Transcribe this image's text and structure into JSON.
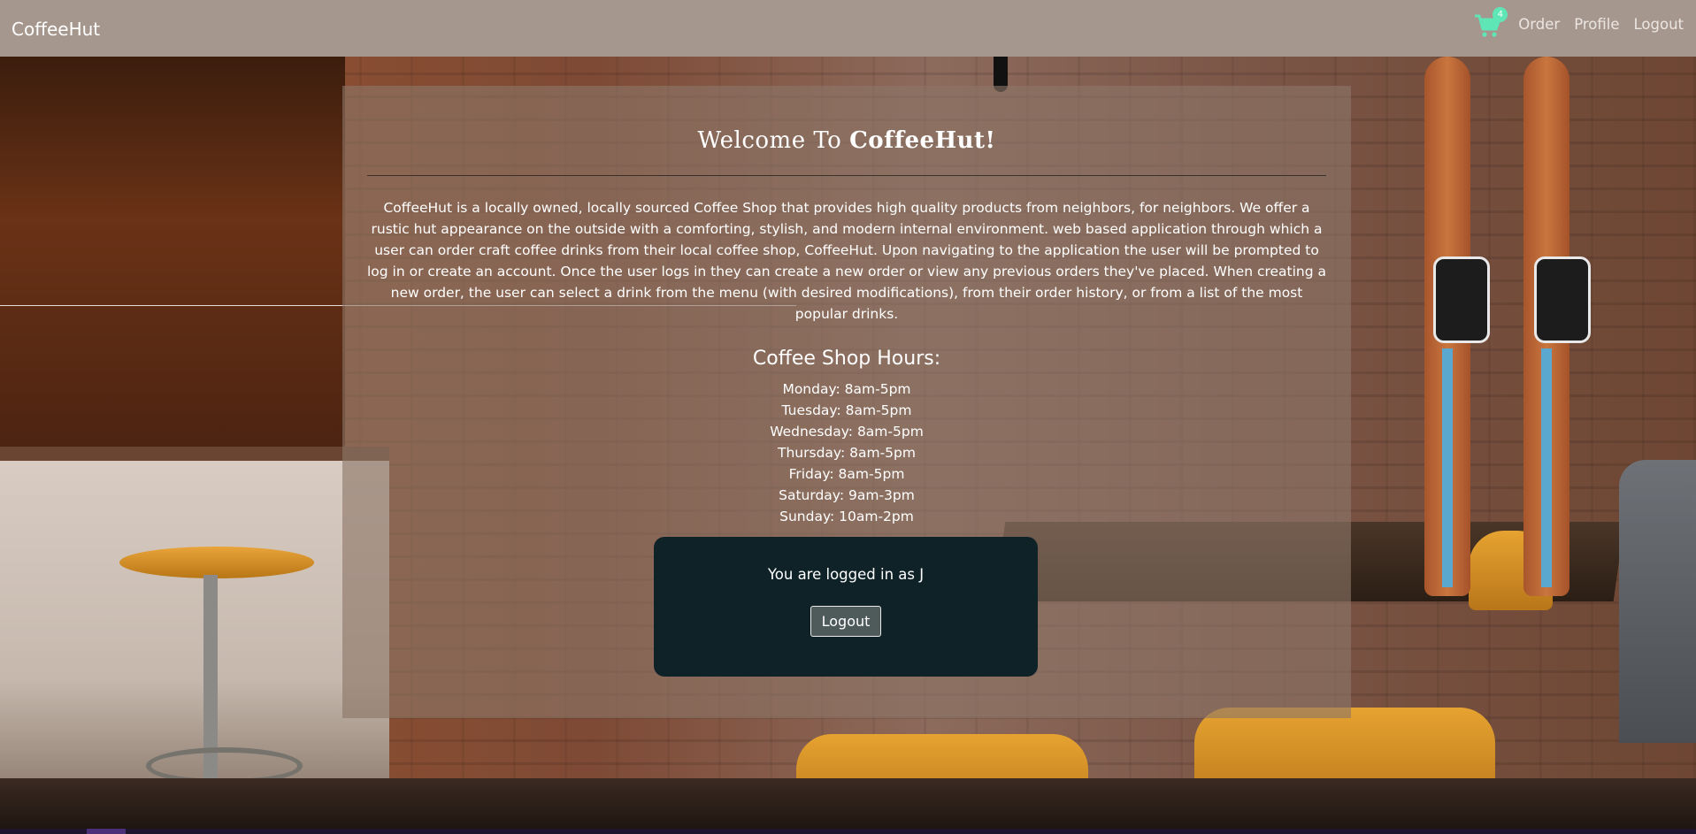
{
  "navbar": {
    "brand": "CoffeeHut",
    "cart_count": "4",
    "cart_icon": "shopping-cart-icon",
    "links": [
      "Order",
      "Profile",
      "Logout"
    ]
  },
  "main": {
    "welcome_prefix": "Welcome To ",
    "welcome_brand": "CoffeeHut!",
    "about": "CoffeeHut is a locally owned, locally sourced Coffee Shop that provides high quality products from neighbors, for neighbors. We offer a rustic hut appearance on the outside with a comforting, stylish, and modern internal environment. web based application through which a user can order craft coffee drinks from their local coffee shop, CoffeeHut. Upon navigating to the application the user will be prompted to log in or create an account. Once the user logs in they can create a new order or view any previous orders they've placed. When creating a new order, the user can select a drink from the menu (with desired modifications), from their order history, or from a list of the most popular drinks.",
    "hours_title": "Coffee Shop Hours:",
    "hours": [
      "Monday: 8am-5pm",
      "Tuesday: 8am-5pm",
      "Wednesday: 8am-5pm",
      "Thursday: 8am-5pm",
      "Friday: 8am-5pm",
      "Saturday: 9am-3pm",
      "Sunday: 10am-2pm"
    ]
  },
  "login_card": {
    "status": "You are logged in as J",
    "logout_label": "Logout"
  },
  "colors": {
    "navbar": "#a6978e",
    "cart_accent": "#5fe6b7",
    "login_card": "#0e2227"
  }
}
